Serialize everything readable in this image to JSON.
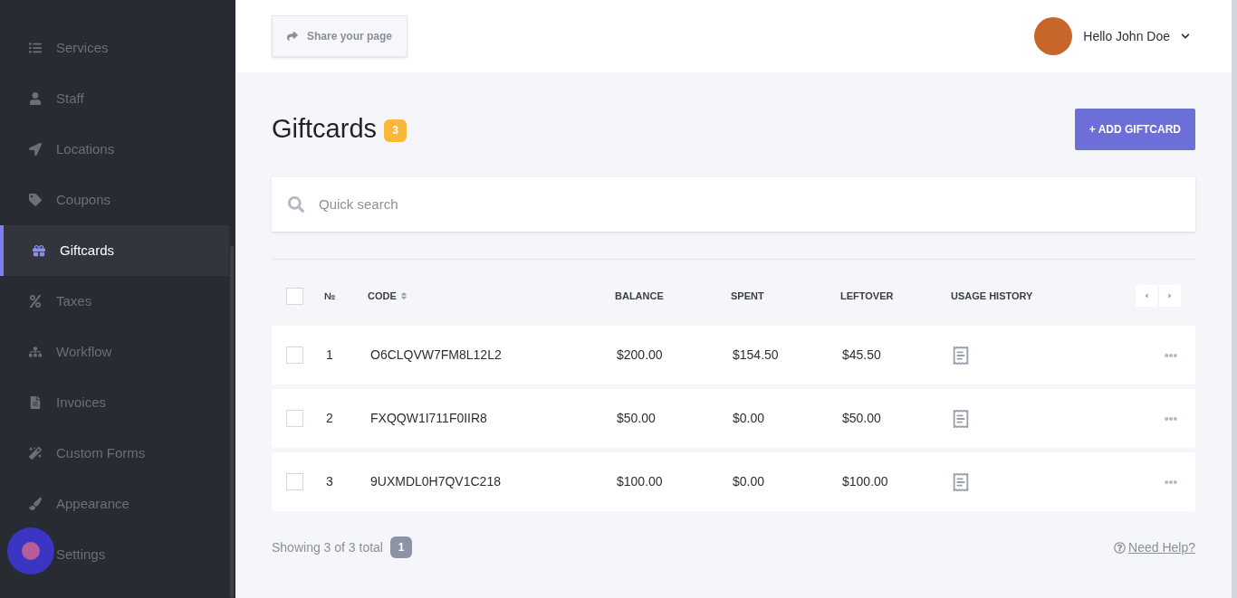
{
  "sidebar": {
    "items": [
      {
        "label": "Services",
        "selected": false
      },
      {
        "label": "Staff",
        "selected": false
      },
      {
        "label": "Locations",
        "selected": false
      },
      {
        "label": "Coupons",
        "selected": false
      },
      {
        "label": "Giftcards",
        "selected": true
      },
      {
        "label": "Taxes",
        "selected": false
      },
      {
        "label": "Workflow",
        "selected": false
      },
      {
        "label": "Invoices",
        "selected": false
      },
      {
        "label": "Custom Forms",
        "selected": false
      },
      {
        "label": "Appearance",
        "selected": false
      },
      {
        "label": "Settings",
        "selected": false
      }
    ]
  },
  "header": {
    "share_button": "Share your page",
    "user_greeting": "Hello John Doe"
  },
  "page": {
    "title": "Giftcards",
    "count_badge": "3",
    "add_button": "+ ADD GIFTCARD"
  },
  "search": {
    "placeholder": "Quick search"
  },
  "table": {
    "select_all_checked": false,
    "columns": [
      "№",
      "CODE",
      "BALANCE",
      "SPENT",
      "LEFTOVER",
      "USAGE HISTORY"
    ],
    "rows": [
      {
        "checked": false,
        "number": "1",
        "code": "O6CLQVW7FM8L12L2",
        "balance": "$200.00",
        "spent": "$154.50",
        "leftover": "$45.50"
      },
      {
        "checked": false,
        "number": "2",
        "code": "FXQQW1I711F0IIR8",
        "balance": "$50.00",
        "spent": "$0.00",
        "leftover": "$50.00"
      },
      {
        "checked": false,
        "number": "3",
        "code": "9UXMDL0H7QV1C218",
        "balance": "$100.00",
        "spent": "$0.00",
        "leftover": "$100.00"
      }
    ]
  },
  "footer": {
    "summary": "Showing 3 of 3 total",
    "page_badge": "1",
    "help_link": "Need Help?"
  }
}
